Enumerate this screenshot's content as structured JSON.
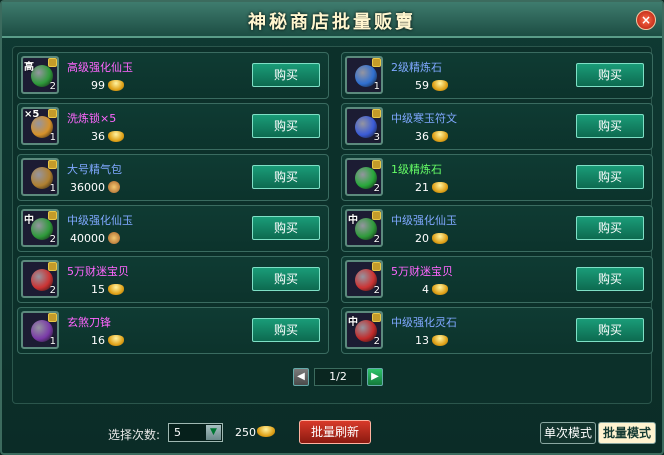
{
  "window": {
    "title": "神秘商店批量贩賣",
    "close_label": "×"
  },
  "items": [
    {
      "name": "高级强化仙玉",
      "name_color": "#ff66ff",
      "qty": "2",
      "price": "99",
      "currency": "ingot",
      "buy_label": "购买",
      "icon_color": "#2e9a3a",
      "badge": "高"
    },
    {
      "name": "2级精炼石",
      "name_color": "#7fa8ff",
      "qty": "1",
      "price": "59",
      "currency": "ingot",
      "buy_label": "购买",
      "icon_color": "#2f6fd0",
      "badge": ""
    },
    {
      "name": "洗炼锁×5",
      "name_color": "#ff66ff",
      "qty": "1",
      "price": "36",
      "currency": "ingot",
      "buy_label": "购买",
      "icon_color": "#d6912a",
      "badge": "×5"
    },
    {
      "name": "中级寒玉符文",
      "name_color": "#7fa8ff",
      "qty": "3",
      "price": "36",
      "currency": "ingot",
      "buy_label": "购买",
      "icon_color": "#3a5bd6",
      "badge": ""
    },
    {
      "name": "大号精气包",
      "name_color": "#7fa8ff",
      "qty": "1",
      "price": "36000",
      "currency": "coin",
      "buy_label": "购买",
      "icon_color": "#b08030",
      "badge": ""
    },
    {
      "name": "1级精炼石",
      "name_color": "#66ff66",
      "qty": "2",
      "price": "21",
      "currency": "ingot",
      "buy_label": "购买",
      "icon_color": "#27a83a",
      "badge": ""
    },
    {
      "name": "中级强化仙玉",
      "name_color": "#7fa8ff",
      "qty": "2",
      "price": "40000",
      "currency": "coin",
      "buy_label": "购买",
      "icon_color": "#2e9a3a",
      "badge": "中"
    },
    {
      "name": "中级强化仙玉",
      "name_color": "#7fa8ff",
      "qty": "2",
      "price": "20",
      "currency": "ingot",
      "buy_label": "购买",
      "icon_color": "#2e9a3a",
      "badge": "中"
    },
    {
      "name": "5万财迷宝贝",
      "name_color": "#ff66ff",
      "qty": "2",
      "price": "15",
      "currency": "ingot",
      "buy_label": "购买",
      "icon_color": "#cc3333",
      "badge": ""
    },
    {
      "name": "5万财迷宝贝",
      "name_color": "#ff66ff",
      "qty": "2",
      "price": "4",
      "currency": "ingot",
      "buy_label": "购买",
      "icon_color": "#cc3333",
      "badge": ""
    },
    {
      "name": "玄煞刀锋",
      "name_color": "#ff66ff",
      "qty": "1",
      "price": "16",
      "currency": "ingot",
      "buy_label": "购买",
      "icon_color": "#7a3aa8",
      "badge": ""
    },
    {
      "name": "中级强化灵石",
      "name_color": "#7fa8ff",
      "qty": "2",
      "price": "13",
      "currency": "ingot",
      "buy_label": "购买",
      "icon_color": "#c22a2a",
      "badge": "中"
    }
  ],
  "pagination": {
    "prev_label": "◀",
    "page": "1/2",
    "next_label": "▶"
  },
  "footer": {
    "select_label": "选择次数:",
    "select_value": "5",
    "select_arrow": "▼",
    "cost": "250",
    "refresh_label": "批量刷新",
    "mode_single": "单次模式",
    "mode_batch": "批量模式"
  }
}
